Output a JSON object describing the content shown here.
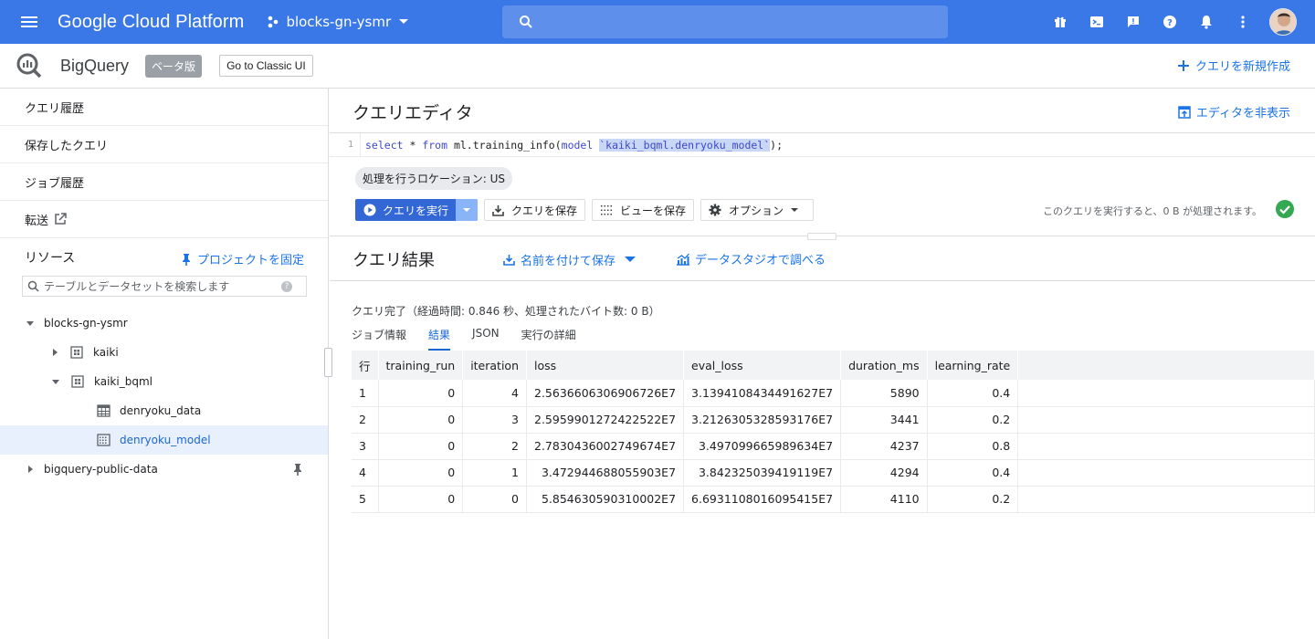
{
  "topbar": {
    "title": "Google Cloud Platform",
    "project": "blocks-gn-ysmr",
    "search_placeholder": ""
  },
  "subbar": {
    "product": "BigQuery",
    "beta_badge": "ベータ版",
    "classic_button": "Go to Classic UI",
    "new_query": "クエリを新規作成"
  },
  "sidebar": {
    "items": [
      {
        "label": "クエリ履歴"
      },
      {
        "label": "保存したクエリ"
      },
      {
        "label": "ジョブ履歴"
      },
      {
        "label": "転送"
      }
    ],
    "resources_label": "リソース",
    "pin_project": "プロジェクトを固定",
    "search_placeholder": "テーブルとデータセットを検索します",
    "tree": {
      "project": "blocks-gn-ysmr",
      "dataset1": "kaiki",
      "dataset2": "kaiki_bqml",
      "table": "denryoku_data",
      "model": "denryoku_model",
      "public": "bigquery-public-data"
    }
  },
  "editor": {
    "title": "クエリエディタ",
    "hide": "エディタを非表示",
    "line_no": "1",
    "code": {
      "kw1": "select",
      "p1": " * ",
      "kw2": "from",
      "p2": " ml.training_info(",
      "kw3": "model",
      "p3": " ",
      "target": "`kaiki_bqml.denryoku_model`",
      "p4": ");"
    },
    "location": "処理を行うロケーション: US",
    "run": "クエリを実行",
    "save_query": "クエリを保存",
    "save_view": "ビューを保存",
    "options": "オプション",
    "process_note": "このクエリを実行すると、0 B が処理されます。"
  },
  "results": {
    "title": "クエリ結果",
    "save_as": "名前を付けて保存",
    "explore": "データスタジオで調べる",
    "status": "クエリ完了（経過時間: 0.846 秒、処理されたバイト数: 0 B）",
    "tabs": [
      "ジョブ情報",
      "結果",
      "JSON",
      "実行の詳細"
    ],
    "columns": [
      "行",
      "training_run",
      "iteration",
      "loss",
      "eval_loss",
      "duration_ms",
      "learning_rate"
    ],
    "rows": [
      [
        "1",
        "0",
        "4",
        "2.5636606306906726E7",
        "3.1394108434491627E7",
        "5890",
        "0.4"
      ],
      [
        "2",
        "0",
        "3",
        "2.5959901272422522E7",
        "3.2126305328593176E7",
        "3441",
        "0.2"
      ],
      [
        "3",
        "0",
        "2",
        "2.7830436002749674E7",
        "3.497099665989634E7",
        "4237",
        "0.8"
      ],
      [
        "4",
        "0",
        "1",
        "3.472944688055903E7",
        "3.842325039419119E7",
        "4294",
        "0.4"
      ],
      [
        "5",
        "0",
        "0",
        "5.854630590310002E7",
        "6.6931108016095415E7",
        "4110",
        "0.2"
      ]
    ]
  },
  "colors": {
    "topbar": "#3b78e7",
    "accent": "#1a73e8",
    "run_button": "#3367d6",
    "success": "#34a853"
  }
}
